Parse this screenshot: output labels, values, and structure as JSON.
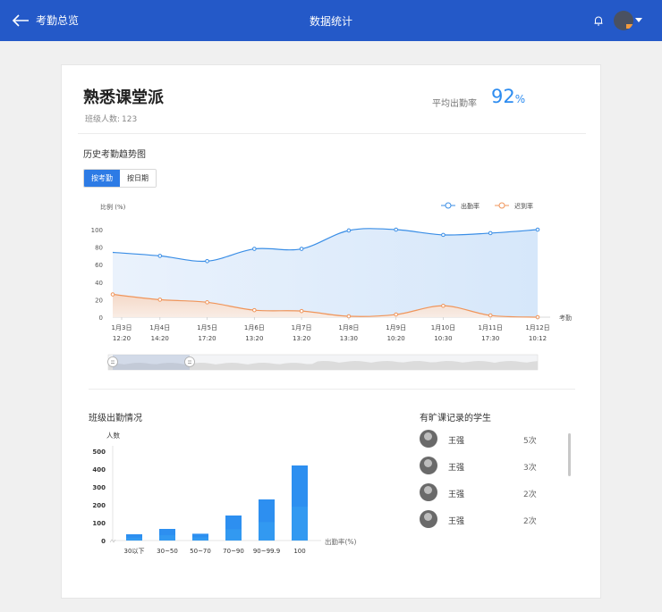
{
  "header": {
    "back_label": "考勤总览",
    "title": "数据统计"
  },
  "class_info": {
    "name": "熟悉课堂派",
    "count_label": "班级人数:",
    "count": "123",
    "avg_label": "平均出勤率",
    "avg_value": "92",
    "avg_unit": "%"
  },
  "trend": {
    "title": "历史考勤趋势图",
    "toggle": [
      "按考勤",
      "按日期"
    ],
    "active_toggle": "按考勤"
  },
  "colors": {
    "header": "#2459c8",
    "attendance": "#3a8ee6",
    "late": "#f0955a"
  },
  "chart_data": [
    {
      "type": "line",
      "ylabel": "比例 (%)",
      "xlabel": "考勤",
      "ylim": [
        0,
        100
      ],
      "yticks": [
        0,
        20,
        40,
        60,
        80,
        100
      ],
      "categories": [
        [
          "1月3日",
          "12:20"
        ],
        [
          "1月4日",
          "14:20"
        ],
        [
          "1月5日",
          "17:20"
        ],
        [
          "1月6日",
          "13:20"
        ],
        [
          "1月7日",
          "13:20"
        ],
        [
          "1月8日",
          "13:30"
        ],
        [
          "1月9日",
          "10:20"
        ],
        [
          "1月10日",
          "10:30"
        ],
        [
          "1月11日",
          "17:30"
        ],
        [
          "1月12日",
          "10:12"
        ]
      ],
      "series": [
        {
          "name": "出勤率",
          "values": [
            74,
            70,
            64,
            78,
            78,
            99,
            100,
            94,
            96,
            100
          ]
        },
        {
          "name": "迟到率",
          "values": [
            26,
            20,
            17,
            8,
            7,
            1,
            3,
            13,
            2,
            0
          ]
        }
      ],
      "legend_position": "top-right",
      "grid": false
    },
    {
      "type": "bar",
      "title": "班级出勤情况",
      "ylabel": "人数",
      "xlabel": "出勤率(%)",
      "ylim": [
        0,
        500
      ],
      "yticks": [
        0,
        100,
        200,
        300,
        400,
        500
      ],
      "categories": [
        "30以下",
        "30~50",
        "50~70",
        "70~90",
        "90~99.9",
        "100"
      ],
      "values": [
        35,
        65,
        38,
        140,
        230,
        420
      ],
      "grid": false
    }
  ],
  "absent": {
    "title": "有旷课记录的学生",
    "students": [
      {
        "name": "王强",
        "count": "5次"
      },
      {
        "name": "王强",
        "count": "3次"
      },
      {
        "name": "王强",
        "count": "2次"
      },
      {
        "name": "王强",
        "count": "2次"
      }
    ]
  }
}
